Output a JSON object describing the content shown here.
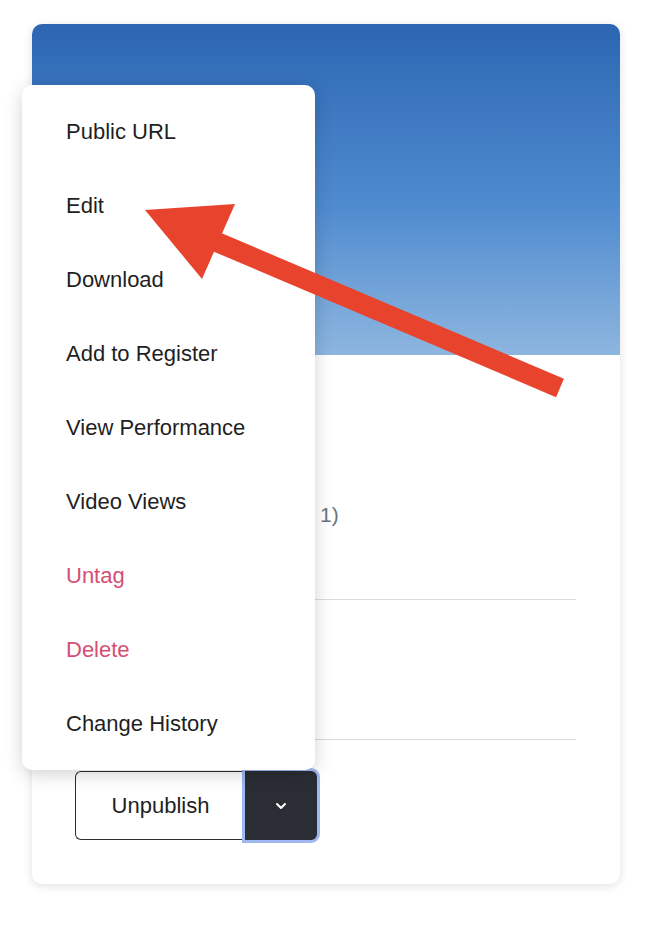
{
  "menu": {
    "items": [
      {
        "label": "Public URL",
        "kind": "normal"
      },
      {
        "label": "Edit",
        "kind": "normal"
      },
      {
        "label": "Download",
        "kind": "normal"
      },
      {
        "label": "Add to Register",
        "kind": "normal"
      },
      {
        "label": "View Performance",
        "kind": "normal"
      },
      {
        "label": "Video Views",
        "kind": "normal"
      },
      {
        "label": "Untag",
        "kind": "danger"
      },
      {
        "label": "Delete",
        "kind": "danger"
      },
      {
        "label": "Change History",
        "kind": "normal"
      }
    ]
  },
  "card": {
    "details": [
      "1)"
    ]
  },
  "actions": {
    "primary": "Unpublish",
    "expanded": true
  }
}
